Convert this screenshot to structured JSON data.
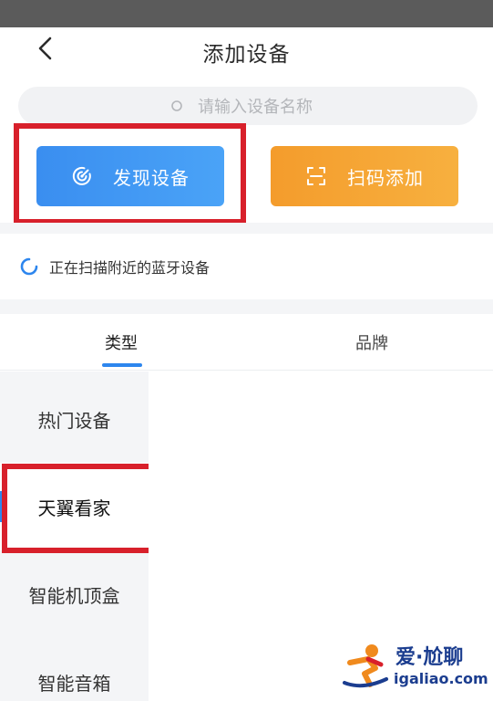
{
  "header": {
    "title": "添加设备"
  },
  "search": {
    "placeholder": "请输入设备名称"
  },
  "actions": {
    "discover_label": "发现设备",
    "scan_label": "扫码添加"
  },
  "scan_status": {
    "text": "正在扫描附近的蓝牙设备"
  },
  "tabs": [
    {
      "label": "类型",
      "active": true
    },
    {
      "label": "品牌",
      "active": false
    }
  ],
  "categories": [
    {
      "label": "热门设备",
      "active": false
    },
    {
      "label": "天翼看家",
      "active": true
    },
    {
      "label": "智能机顶盒",
      "active": false
    },
    {
      "label": "智能音箱",
      "active": false
    }
  ],
  "watermark": {
    "brand": "爱·尬聊",
    "url": "igaliao.com"
  },
  "colors": {
    "accent_blue": "#2d86ee",
    "discover_button": "#3a8ef0",
    "scan_button": "#f49c2c",
    "highlight_red": "#d8202b",
    "status_bar": "#5b5b5b"
  },
  "icons": {
    "back": "chevron-left-icon",
    "search": "search-icon",
    "discover": "radar-icon",
    "scan": "scan-frame-icon",
    "status": "spinner-icon"
  }
}
